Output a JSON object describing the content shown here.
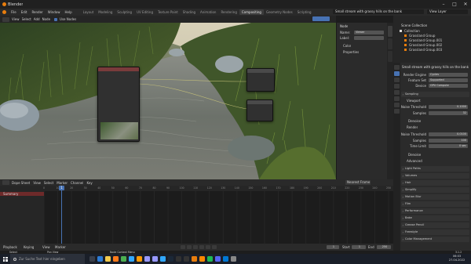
{
  "window": {
    "title": "Blender",
    "min_icon": "minimize-icon",
    "max_icon": "maximize-icon",
    "close_icon": "close-icon"
  },
  "menu": {
    "items": [
      "File",
      "Edit",
      "Render",
      "Window",
      "Help"
    ]
  },
  "workspaces": [
    "Layout",
    "Modeling",
    "Sculpting",
    "UV Editing",
    "Texture Paint",
    "Shading",
    "Animation",
    "Rendering",
    "Compositing",
    "Geometry Nodes",
    "Scripting"
  ],
  "active_workspace": "Compositing",
  "scene": {
    "name": "Small stream with grassy hills on the bank",
    "view_layer": "View Layer"
  },
  "viewport_header": {
    "view": "View",
    "select": "Select",
    "add": "Add",
    "node": "Node",
    "use_nodes": "Use Nodes"
  },
  "node_sidebar": {
    "tab": "Node",
    "name_label": "Name:",
    "name_value": "Viewer",
    "label_label": "Label:",
    "color_label": "Color",
    "properties_label": "Properties"
  },
  "outliner": {
    "title": "Scene Collection",
    "items": [
      "Collection",
      "Grassland Group",
      "Grassland Group.001",
      "Grassland Group.002",
      "Grassland Group.003"
    ]
  },
  "properties": {
    "scene_name": "Small stream with grassy hills on the bank",
    "render_engine_label": "Render Engine",
    "render_engine": "Cycles",
    "feature_set_label": "Feature Set",
    "feature_set": "Supported",
    "device_label": "Device",
    "device": "GPU Compute",
    "sampling": "Sampling",
    "viewport": "Viewport",
    "noise_threshold_label": "Noise Threshold",
    "noise_threshold_1": "0.1000",
    "max_samples_label": "Samples",
    "max_samples_1": "32",
    "denoise_label": "Denoise",
    "render": "Render",
    "noise_threshold_2": "0.0100",
    "max_samples_2": "100",
    "time_limit_label": "Time Limit",
    "time_limit": "0 sec",
    "denoise_2": "Denoise",
    "advanced": "Advanced",
    "sections": [
      "Light Paths",
      "Volumes",
      "Hair",
      "Simplify",
      "Motion Blur",
      "Film",
      "Performance",
      "Bake",
      "Grease Pencil",
      "Freestyle",
      "Color Management"
    ]
  },
  "timeline": {
    "menus": [
      "Dope Sheet",
      "View",
      "Select",
      "Marker",
      "Channel",
      "Key"
    ],
    "mode": "Summary",
    "filter": "Nearest Frame",
    "current_frame": "1",
    "ruler": [
      "0",
      "10",
      "20",
      "30",
      "40",
      "50",
      "60",
      "70",
      "80",
      "90",
      "100",
      "110",
      "120",
      "130",
      "140",
      "150",
      "160",
      "170",
      "180",
      "190",
      "200",
      "210",
      "220",
      "230",
      "240",
      "250"
    ],
    "playback": "Playback",
    "keying": "Keying",
    "view": "View",
    "marker": "Marker",
    "start_label": "Start",
    "start": "1",
    "end_label": "End",
    "end": "250"
  },
  "status": {
    "left": "Select",
    "mid": "Pan View",
    "right": "Node Context Menu",
    "version": "3.1.2"
  },
  "taskbar": {
    "search_placeholder": "Zur Suche Text hier eingeben",
    "time": "06:03",
    "date": "27.04.2022",
    "icons": [
      "windows-icon",
      "search-icon",
      "taskview-icon",
      "edge-icon",
      "explorer-icon",
      "firefox-icon",
      "chrome-icon",
      "photoshop-icon",
      "illustrator-icon",
      "premiere-icon",
      "aftereffects-icon",
      "lightroom-icon",
      "steam-icon",
      "epic-icon",
      "obs-icon",
      "blender-icon",
      "vlc-icon",
      "spotify-icon",
      "discord-icon",
      "mail-icon",
      "settings-icon"
    ]
  },
  "colors": {
    "accent": "#e87d0d",
    "active_tab": "#3d3d3d",
    "selection": "#4772b3",
    "timeline_cursor": "#4772b3",
    "summary": "#6e2a2a"
  }
}
